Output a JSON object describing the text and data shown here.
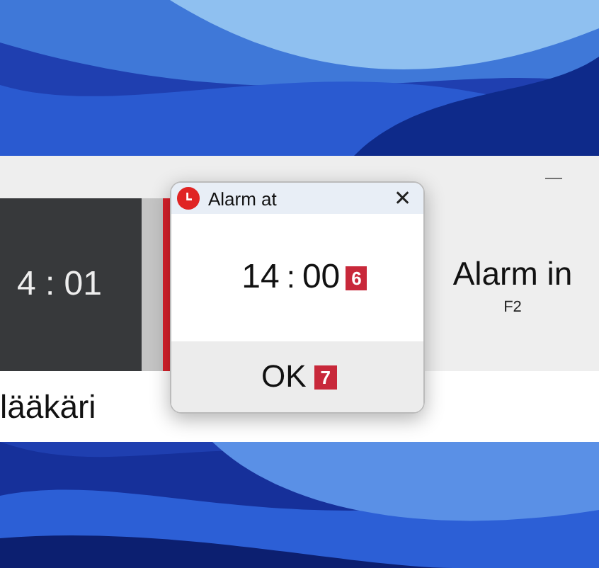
{
  "window": {
    "minimize": "—",
    "countdown": "4 : 01",
    "alarm_label": "Alarm in",
    "alarm_key": "F2",
    "note": "lääkäri"
  },
  "dialog": {
    "title": "Alarm at",
    "close": "✕",
    "hours": "14",
    "separator": ":",
    "minutes": "00",
    "time_badge": "6",
    "ok": "OK",
    "ok_badge": "7"
  }
}
